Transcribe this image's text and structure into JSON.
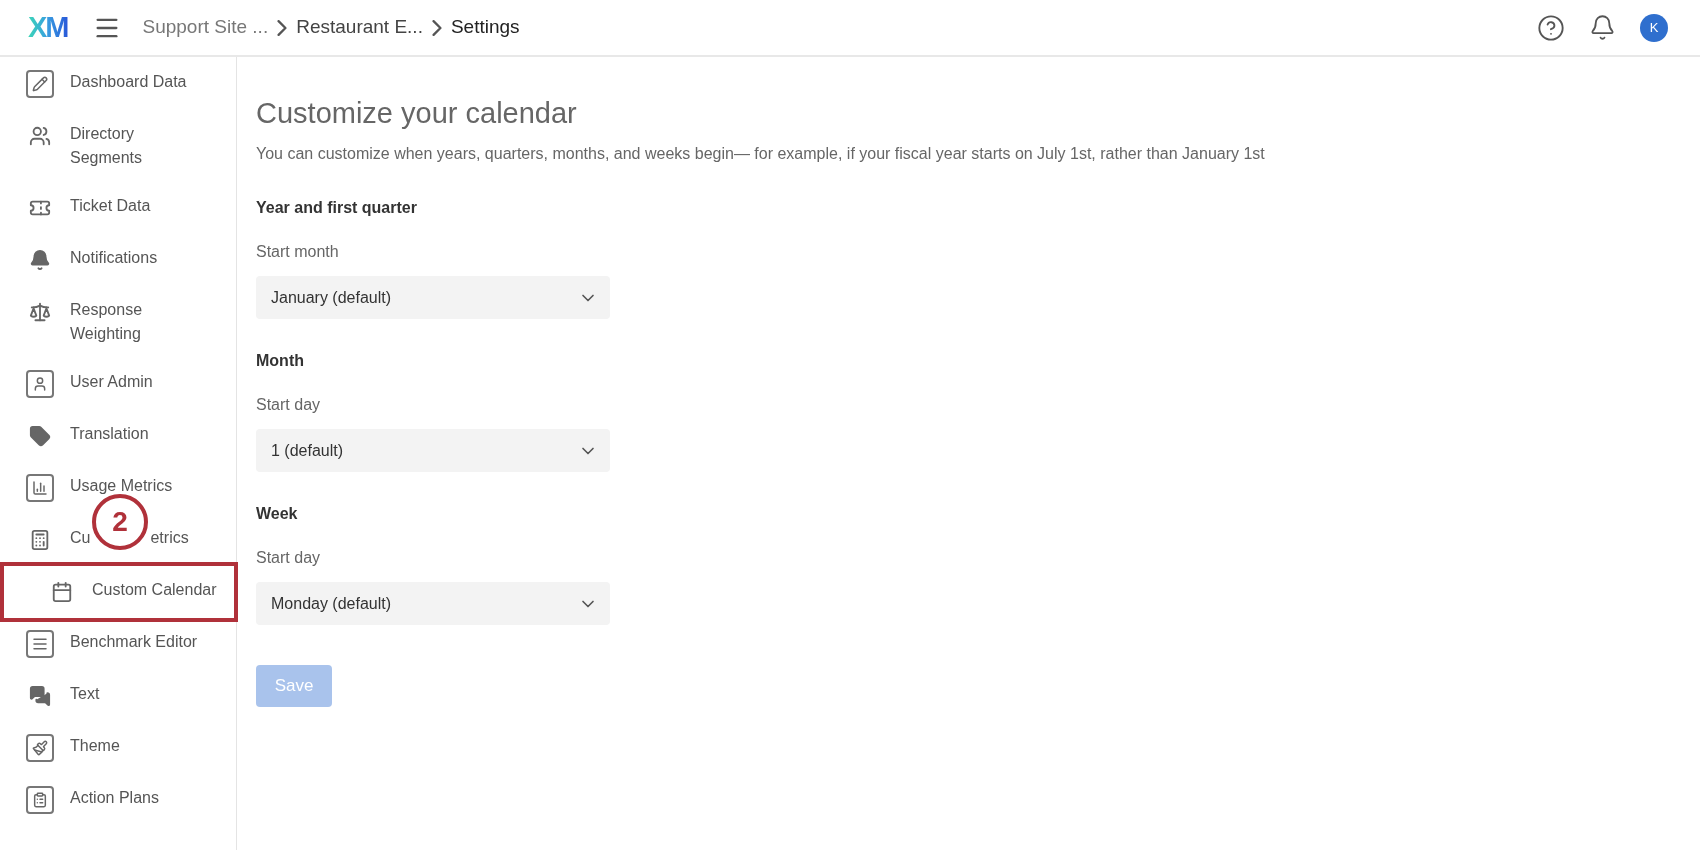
{
  "header": {
    "logo": "XM",
    "breadcrumbs": [
      "Support Site ...",
      "Restaurant E...",
      "Settings"
    ],
    "avatar": "K"
  },
  "sidebar": {
    "items": [
      {
        "label": "Dashboard Data",
        "highlighted": false
      },
      {
        "lines": [
          "Directory",
          "Segments"
        ],
        "highlighted": false
      },
      {
        "label": "Ticket Data",
        "highlighted": false
      },
      {
        "label": "Notifications",
        "highlighted": false
      },
      {
        "lines": [
          "Response",
          "Weighting"
        ],
        "highlighted": false
      },
      {
        "label": "User Admin",
        "highlighted": false
      },
      {
        "label": "Translation",
        "highlighted": false
      },
      {
        "label": "Usage Metrics",
        "highlighted": false
      },
      {
        "label_parts": [
          "Cu",
          "etrics"
        ],
        "highlighted": false,
        "callout": "2"
      },
      {
        "label": "Custom Calendar",
        "highlighted": true
      },
      {
        "label": "Benchmark Editor",
        "highlighted": false
      },
      {
        "label": "Text",
        "highlighted": false
      },
      {
        "label": "Theme",
        "highlighted": false
      },
      {
        "label": "Action Plans",
        "highlighted": false
      }
    ]
  },
  "content": {
    "title": "Customize your calendar",
    "description": "You can customize when years, quarters, months, and weeks begin— for example, if your fiscal year starts on July 1st, rather than January 1st",
    "sections": [
      {
        "heading": "Year and first quarter",
        "label": "Start month",
        "value": "January (default)"
      },
      {
        "heading": "Month",
        "label": "Start day",
        "value": "1 (default)"
      },
      {
        "heading": "Week",
        "label": "Start day",
        "value": "Monday (default)"
      }
    ],
    "save_button": {
      "label": "Save",
      "disabled": true
    }
  }
}
